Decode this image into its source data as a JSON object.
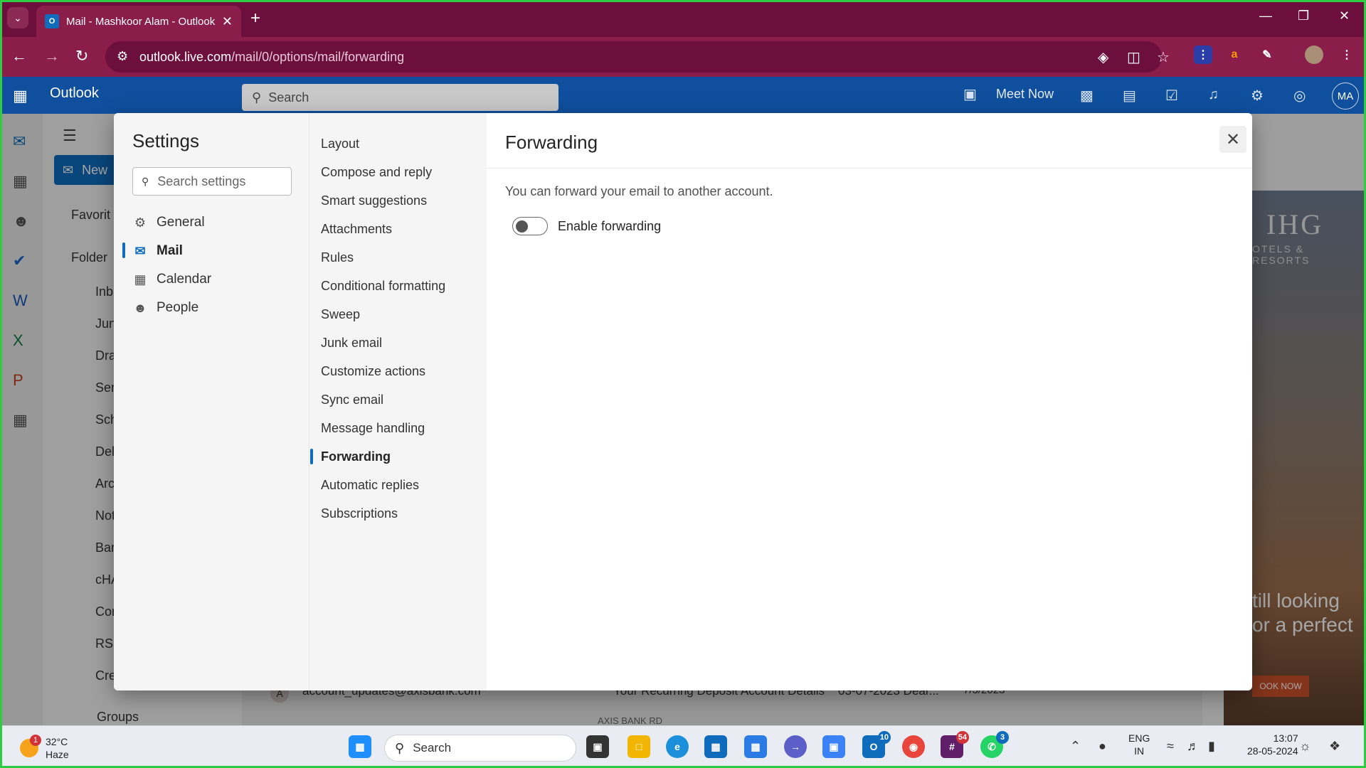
{
  "browser": {
    "tab_title": "Mail - Mashkoor Alam - Outlook",
    "url_host": "outlook.live.com",
    "url_path": "/mail/0/options/mail/forwarding"
  },
  "outlook": {
    "brand": "Outlook",
    "search_placeholder": "Search",
    "meet_now": "Meet Now",
    "avatar_initials": "MA",
    "new_mail": "New",
    "folders": [
      "Favorit",
      "Folder",
      "Inb",
      "Jun",
      "Dra",
      "Sen",
      "Sch",
      "Del",
      "Arc",
      "Not",
      "Bar",
      "cHA",
      "Con",
      "RSS",
      "Cre",
      "Groups"
    ],
    "email_row": {
      "avatar": "A",
      "sender": "account_updates@axisbank.com",
      "subject": "Your Recurring Deposit Account Details",
      "preview": "03-07-2023 Dear...",
      "date": "7/3/2023",
      "attachment": "AXIS BANK RD"
    },
    "ad": {
      "brand": "IHG",
      "tagline": "OTELS & RESORTS",
      "headline_1": "till looking",
      "headline_2": "or a perfect",
      "cta": "OOK NOW"
    }
  },
  "settings": {
    "title": "Settings",
    "search_placeholder": "Search settings",
    "categories": [
      {
        "label": "General",
        "icon": "gear-icon"
      },
      {
        "label": "Mail",
        "icon": "mail-icon"
      },
      {
        "label": "Calendar",
        "icon": "calendar-icon"
      },
      {
        "label": "People",
        "icon": "people-icon"
      }
    ],
    "active_category": "Mail",
    "mail_sections": [
      "Layout",
      "Compose and reply",
      "Smart suggestions",
      "Attachments",
      "Rules",
      "Conditional formatting",
      "Sweep",
      "Junk email",
      "Customize actions",
      "Sync email",
      "Message handling",
      "Forwarding",
      "Automatic replies",
      "Subscriptions"
    ],
    "active_section": "Forwarding",
    "page": {
      "title": "Forwarding",
      "description": "You can forward your email to another account.",
      "toggle_label": "Enable forwarding",
      "toggle_on": false
    }
  },
  "taskbar": {
    "weather_temp": "32°C",
    "weather_cond": "Haze",
    "weather_badge": "1",
    "search_label": "Search",
    "lang_1": "ENG",
    "lang_2": "IN",
    "time": "13:07",
    "date": "28-05-2024",
    "badges": {
      "outlook": "10",
      "slack": "54",
      "whatsapp": "3"
    }
  },
  "colors": {
    "accent": "#0f6cbd",
    "browser_frame": "#8b1d4b",
    "outlook_header": "#0f4f9d"
  }
}
